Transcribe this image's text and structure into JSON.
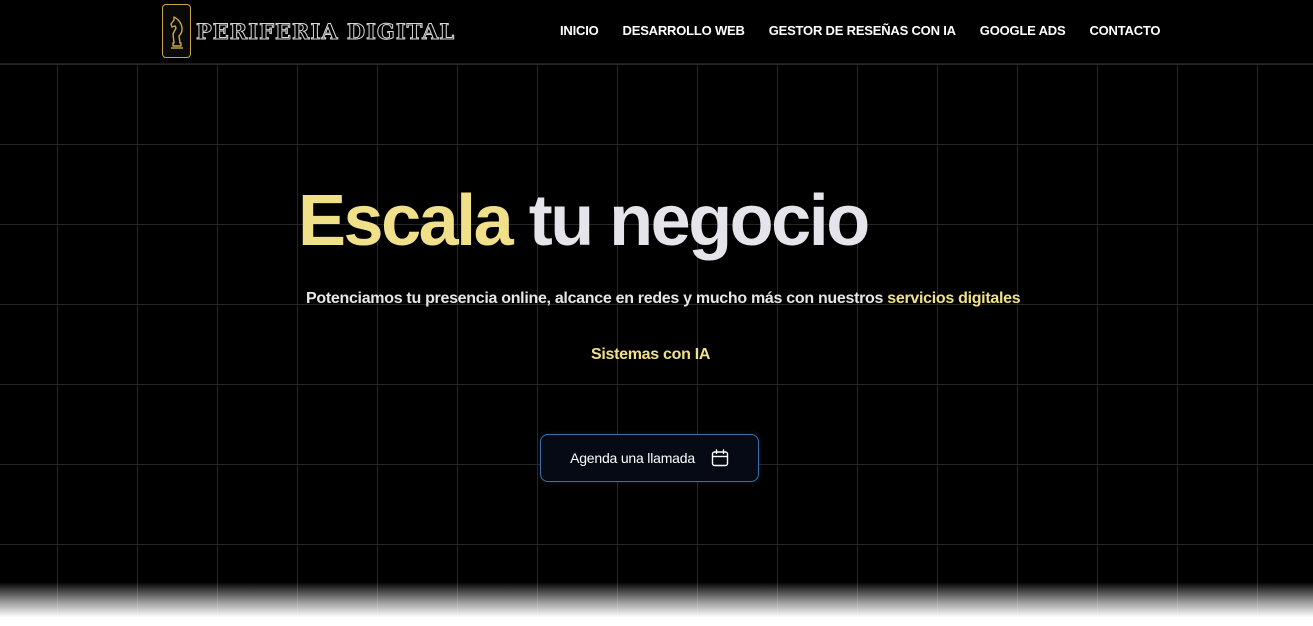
{
  "brand": {
    "name": "PERIFERIA DIGITAL",
    "logo_icon": "chess-knight-icon",
    "accent_color": "#f0e08a"
  },
  "nav": {
    "items": [
      {
        "label": "INICIO"
      },
      {
        "label": "DESARROLLO WEB"
      },
      {
        "label": "GESTOR DE RESEÑAS CON IA"
      },
      {
        "label": "GOOGLE ADS"
      },
      {
        "label": "CONTACTO"
      }
    ]
  },
  "hero": {
    "title_accent": "Escala",
    "title_rest": "tu negocio",
    "subtitle_main": "Potenciamos tu presencia online, alcance en redes y mucho más con nuestros ",
    "subtitle_highlight": "servicios digitales",
    "tagline": "Sistemas con IA",
    "cta_label": "Agenda una llamada",
    "cta_icon": "calendar-icon"
  }
}
